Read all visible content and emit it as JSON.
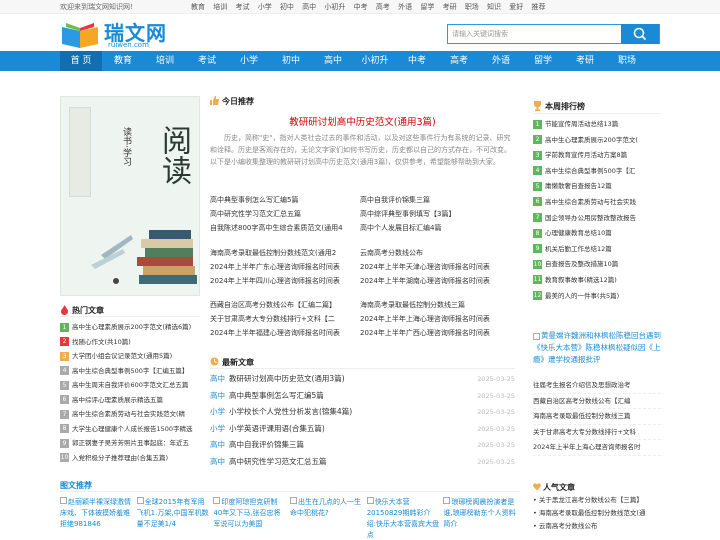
{
  "topbar": {
    "welcome": "欢迎来到瑞文网知识网!",
    "links": [
      "教育",
      "培训",
      "考试",
      "小学",
      "初中",
      "高中",
      "小初升",
      "中考",
      "高考",
      "外语",
      "留学",
      "考研",
      "职场",
      "知识",
      "爱好",
      "推荐"
    ]
  },
  "logo": {
    "cn": "瑞文网",
    "en": "ruiwen.com"
  },
  "search": {
    "placeholder": "请输入关键词搜索"
  },
  "nav": [
    "首 页",
    "教育",
    "培训",
    "考试",
    "小学",
    "初中",
    "高中",
    "小初升",
    "中考",
    "高考",
    "外语",
    "留学",
    "考研",
    "职场"
  ],
  "hero": {
    "title": "阅读",
    "sub": "读书·学习"
  },
  "hot": {
    "title": "热门文章",
    "items": [
      "高中生心理素质展示200字范文(精选6篇)",
      "找随心作文(共10篇)",
      "大学团小组会议记录范文(通用5篇)",
      "高中生综合典型事例500字【汇编五篇】",
      "高中生周末自我评价600字范文汇总五篇",
      "高中综评心理素质展示精选五篇",
      "高中生综合素质劳动与社会实践范文(精",
      "大学生心理健康个人成长报告1500字精选",
      "郭正钢妻子吴芳芳照片丑事起底：年近五",
      "入党积极分子推荐理由(合集五篇)"
    ]
  },
  "today": {
    "title": "今日推荐",
    "feature": "教研研讨划高中历史范文(通用3篇)",
    "desc": "历史，简称\"史\"，指对人类社会过去的事件和活动，以及对这些事件行为有系统的记录、研究和诠释。历史是客观存在的，无论文字家们如何书写历史，历史都以自己的方式存在，不可改变。以下是小编收集整理的教研研讨划高中历史范文(通用3篇)，仅供参考，希望能够帮助到大家。"
  },
  "links_a": [
    [
      "高中典型事例怎么写汇编5篇",
      "高中自我评价锦集三篇"
    ],
    [
      "高中研究性学习范文汇总五篇",
      "高中综评典型事例填写【3篇】"
    ],
    [
      "自我陈述800字高中生综合素质范文(通用4",
      "高中个人发展目标汇编4篇"
    ]
  ],
  "links_b": [
    [
      "海南高考录取最低控制分数线范文(通用2",
      "云南高考分数线公布"
    ],
    [
      "2024年上半年广东心理咨询师报名时间表",
      "2024年上半年天津心理咨询师报名时间表"
    ],
    [
      "2024年上半年四川心理咨询师报名时间表",
      "2024年上半年湖南心理咨询师报名时间表"
    ]
  ],
  "links_c": [
    [
      "西藏自治区高考分数线公布【汇编二篇】",
      "海南高考录取最低控制分数线三篇"
    ],
    [
      "关于甘肃高考大专分数线排行+文科【二",
      "2024年上半年上海心理咨询师报名时间表"
    ],
    [
      "2024年上半年福建心理咨询师报名时间表",
      "2024年上半年广西心理咨询师报名时间表"
    ]
  ],
  "latest": {
    "title": "最新文章",
    "items": [
      {
        "cat": "高中",
        "text": "教研研讨划高中历史范文(通用3篇)",
        "date": "2025-03-25"
      },
      {
        "cat": "高中",
        "text": "高中典型事例怎么写汇编5篇",
        "date": "2025-03-25"
      },
      {
        "cat": "小学",
        "text": "小学校长个人党性分析发言(锦集4篇)",
        "date": "2025-03-25"
      },
      {
        "cat": "小学",
        "text": "小学英语评课用语(合集五篇)",
        "date": "2025-03-25"
      },
      {
        "cat": "高中",
        "text": "高中自我评价锦集三篇",
        "date": "2025-03-25"
      },
      {
        "cat": "高中",
        "text": "高中研究性学习范文汇总五篇",
        "date": "2025-03-25"
      }
    ]
  },
  "rank": {
    "title": "本周排行榜",
    "items": [
      "节能宣传周活动总结13篇",
      "高中生心理素质展示200字范文(",
      "学前教育宣传月活动方案8篇",
      "高中生综合典型事例500字【汇",
      "庸懒散奢自查报告12篇",
      "高中生综合素质劳动与社会实践",
      "国企领导办公用房整改整改报告",
      "心理健康教育总结10篇",
      "机关后勤工作总结12篇",
      "自查报告及整改措施10篇",
      "教育叙事故事(精选12篇)",
      "最美的人的一件事(共5篇)"
    ]
  },
  "ad": "黄曼嫦许魏洲和林枫松陈稳回台遇到《快乐大本营》陈稳林枫松疑似因《上瘾》遭学校通报批评",
  "rlist": [
    "往届考生报名介绍信及思想政治考",
    "西藏自治区高考分数线公布【汇编",
    "海南高考录取最低控制分数线三篇",
    "关于甘肃高考大专分数线排行+文科",
    "2024年上半年上海心理咨询师报名时"
  ],
  "picrec": {
    "title": "图文推荐",
    "items": [
      "赵丽颖半裸深绿激情床戏、下体被摸娇羞难拒绝981846",
      "全球2015年有军用飞机1.万架,中国军机数量不足美1/4",
      "印度阿琼担克研制40年又下马,张召忠将军说可以为美国",
      "出生在几点的人一生命中犯桃花?",
      "快乐大本营20150829期韩彩介绍:快乐大本营喜宾大盘点",
      "琅琊榜阁晨扮演者是谁,琅琊榜勒东个人资料简介"
    ]
  },
  "popular": {
    "title": "人气文章",
    "items": [
      "关于黑龙江高考分数线公布【三篇】",
      "海南高考录取最低控制分数线范文(通",
      "云南高考分数线公布"
    ]
  },
  "colors": {
    "brand": "#1a8ad6",
    "accent": "#c00"
  }
}
